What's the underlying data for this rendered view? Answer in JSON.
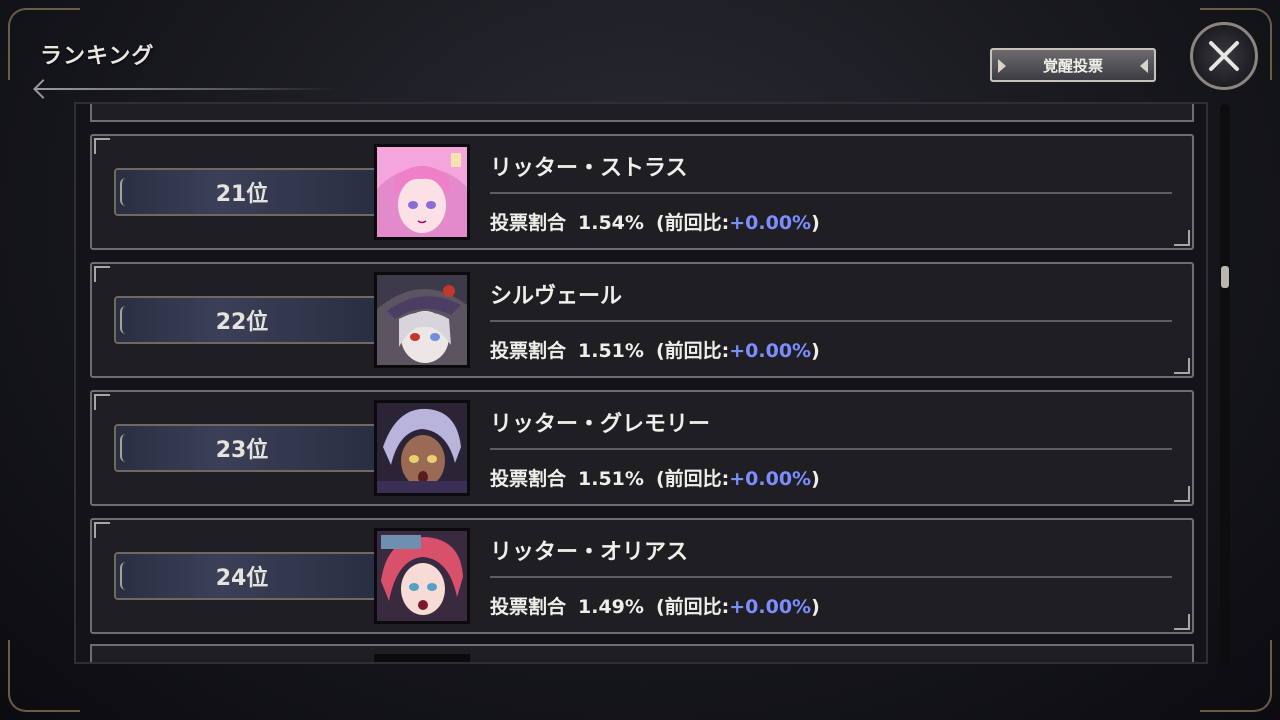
{
  "header": {
    "title": "ランキング",
    "awaken_vote_label": "覚醒投票"
  },
  "labels": {
    "vote_share": "投票割合",
    "prev_compare": "(前回比:",
    "close_paren": ")"
  },
  "colors": {
    "delta_text": "#7d8dff",
    "rank_plate": "#3b4058"
  },
  "rankings": [
    {
      "rank": "21位",
      "name": "リッター・ストラス",
      "vote_pct": "1.54%",
      "delta": "+0.00%",
      "avatar": "pink-hair-avatar"
    },
    {
      "rank": "22位",
      "name": "シルヴェール",
      "vote_pct": "1.51%",
      "delta": "+0.00%",
      "avatar": "silver-hair-hat-avatar"
    },
    {
      "rank": "23位",
      "name": "リッター・グレモリー",
      "vote_pct": "1.51%",
      "delta": "+0.00%",
      "avatar": "lavender-hair-avatar"
    },
    {
      "rank": "24位",
      "name": "リッター・オリアス",
      "vote_pct": "1.49%",
      "delta": "+0.00%",
      "avatar": "red-hair-avatar"
    }
  ]
}
